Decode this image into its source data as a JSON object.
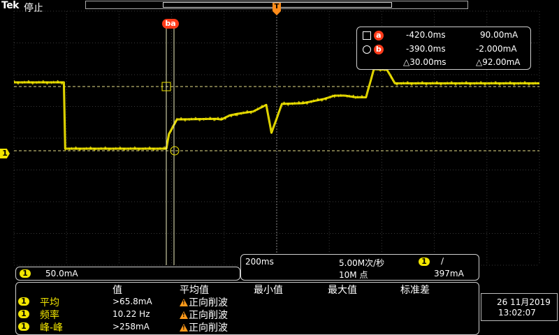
{
  "header": {
    "brand": "Tek",
    "status": "停止"
  },
  "cursors": {
    "a_label": "a",
    "b_label": "b",
    "cursor_tag": "ba",
    "readout": {
      "a_time": "-420.0ms",
      "a_value": "90.00mA",
      "b_time": "-390.0ms",
      "b_value": "-2.000mA",
      "delta_time": "△30.00ms",
      "delta_value": "△92.00mA"
    }
  },
  "trigger_marker": "T",
  "channel": {
    "number": "1",
    "scale": "50.0mA"
  },
  "timebase": {
    "time_per_div": "200ms",
    "sample_rate": "5.00M次/秒",
    "record_length": "10M 点",
    "trigger_channel": "1",
    "trigger_slope": "∕",
    "trigger_level": "397mA"
  },
  "measurements": {
    "columns": [
      "值",
      "平均值",
      "最小值",
      "最大值",
      "标准差"
    ],
    "rows": [
      {
        "channel": "1",
        "name": "平均",
        "value": ">65.8mA",
        "mean": "正向削波"
      },
      {
        "channel": "1",
        "name": "频率",
        "value": "10.22 Hz",
        "mean": "正向削波"
      },
      {
        "channel": "1",
        "name": "峰-峰",
        "value": ">258mA",
        "mean": "正向削波"
      }
    ]
  },
  "clock": {
    "date": "26 11月2019",
    "time": "13:02:07"
  },
  "colors": {
    "trace": "#f2e600",
    "cursor_label": "#ff3b1a",
    "warning": "#ff9a1a",
    "trigger": "#ff8c1a"
  },
  "waveform": {
    "unit": "mA",
    "series": [
      {
        "t_ms": -1000,
        "mA": 200
      },
      {
        "t_ms": -810,
        "mA": 200
      },
      {
        "t_ms": -805,
        "mA": 0
      },
      {
        "t_ms": -420,
        "mA": 0
      },
      {
        "t_ms": -410,
        "mA": 44
      },
      {
        "t_ms": -380,
        "mA": 88
      },
      {
        "t_ms": -230,
        "mA": 90
      },
      {
        "t_ms": -210,
        "mA": 88
      },
      {
        "t_ms": -180,
        "mA": 100
      },
      {
        "t_ms": -150,
        "mA": 105
      },
      {
        "t_ms": -90,
        "mA": 112
      },
      {
        "t_ms": -40,
        "mA": 132
      },
      {
        "t_ms": -20,
        "mA": 48
      },
      {
        "t_ms": 20,
        "mA": 135
      },
      {
        "t_ms": 100,
        "mA": 137
      },
      {
        "t_ms": 180,
        "mA": 150
      },
      {
        "t_ms": 220,
        "mA": 160
      },
      {
        "t_ms": 260,
        "mA": 160
      },
      {
        "t_ms": 300,
        "mA": 155
      },
      {
        "t_ms": 340,
        "mA": 155
      },
      {
        "t_ms": 370,
        "mA": 240
      },
      {
        "t_ms": 420,
        "mA": 238
      },
      {
        "t_ms": 450,
        "mA": 197
      },
      {
        "t_ms": 1000,
        "mA": 197
      }
    ]
  }
}
